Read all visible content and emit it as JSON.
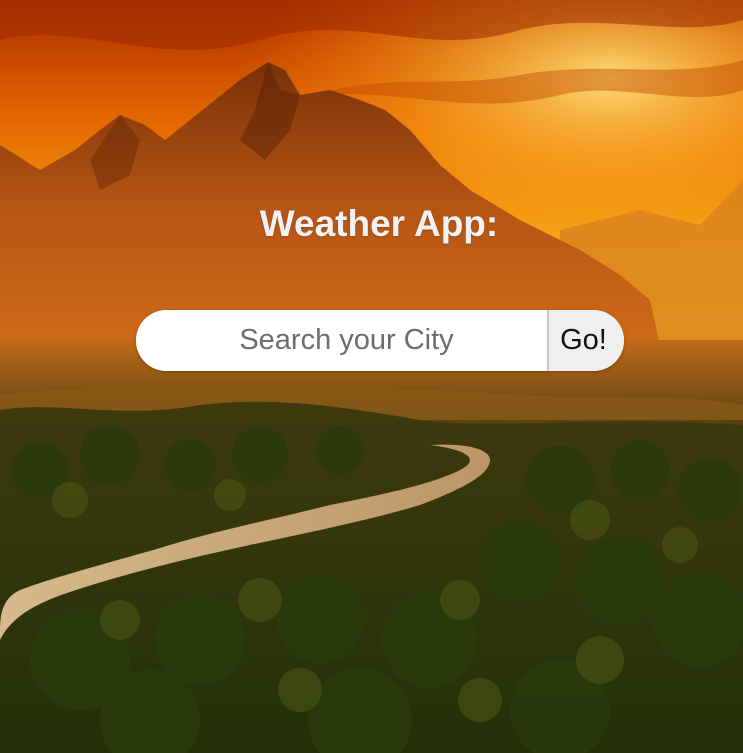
{
  "app": {
    "title": "Weather App:"
  },
  "search": {
    "placeholder": "Search your City",
    "value": "",
    "button_label": "Go!"
  },
  "background": {
    "description_icon": "mountain-landscape-image"
  },
  "colors": {
    "title_text": "#f2f2f6",
    "input_bg": "#ffffff",
    "button_bg": "#efefef"
  }
}
